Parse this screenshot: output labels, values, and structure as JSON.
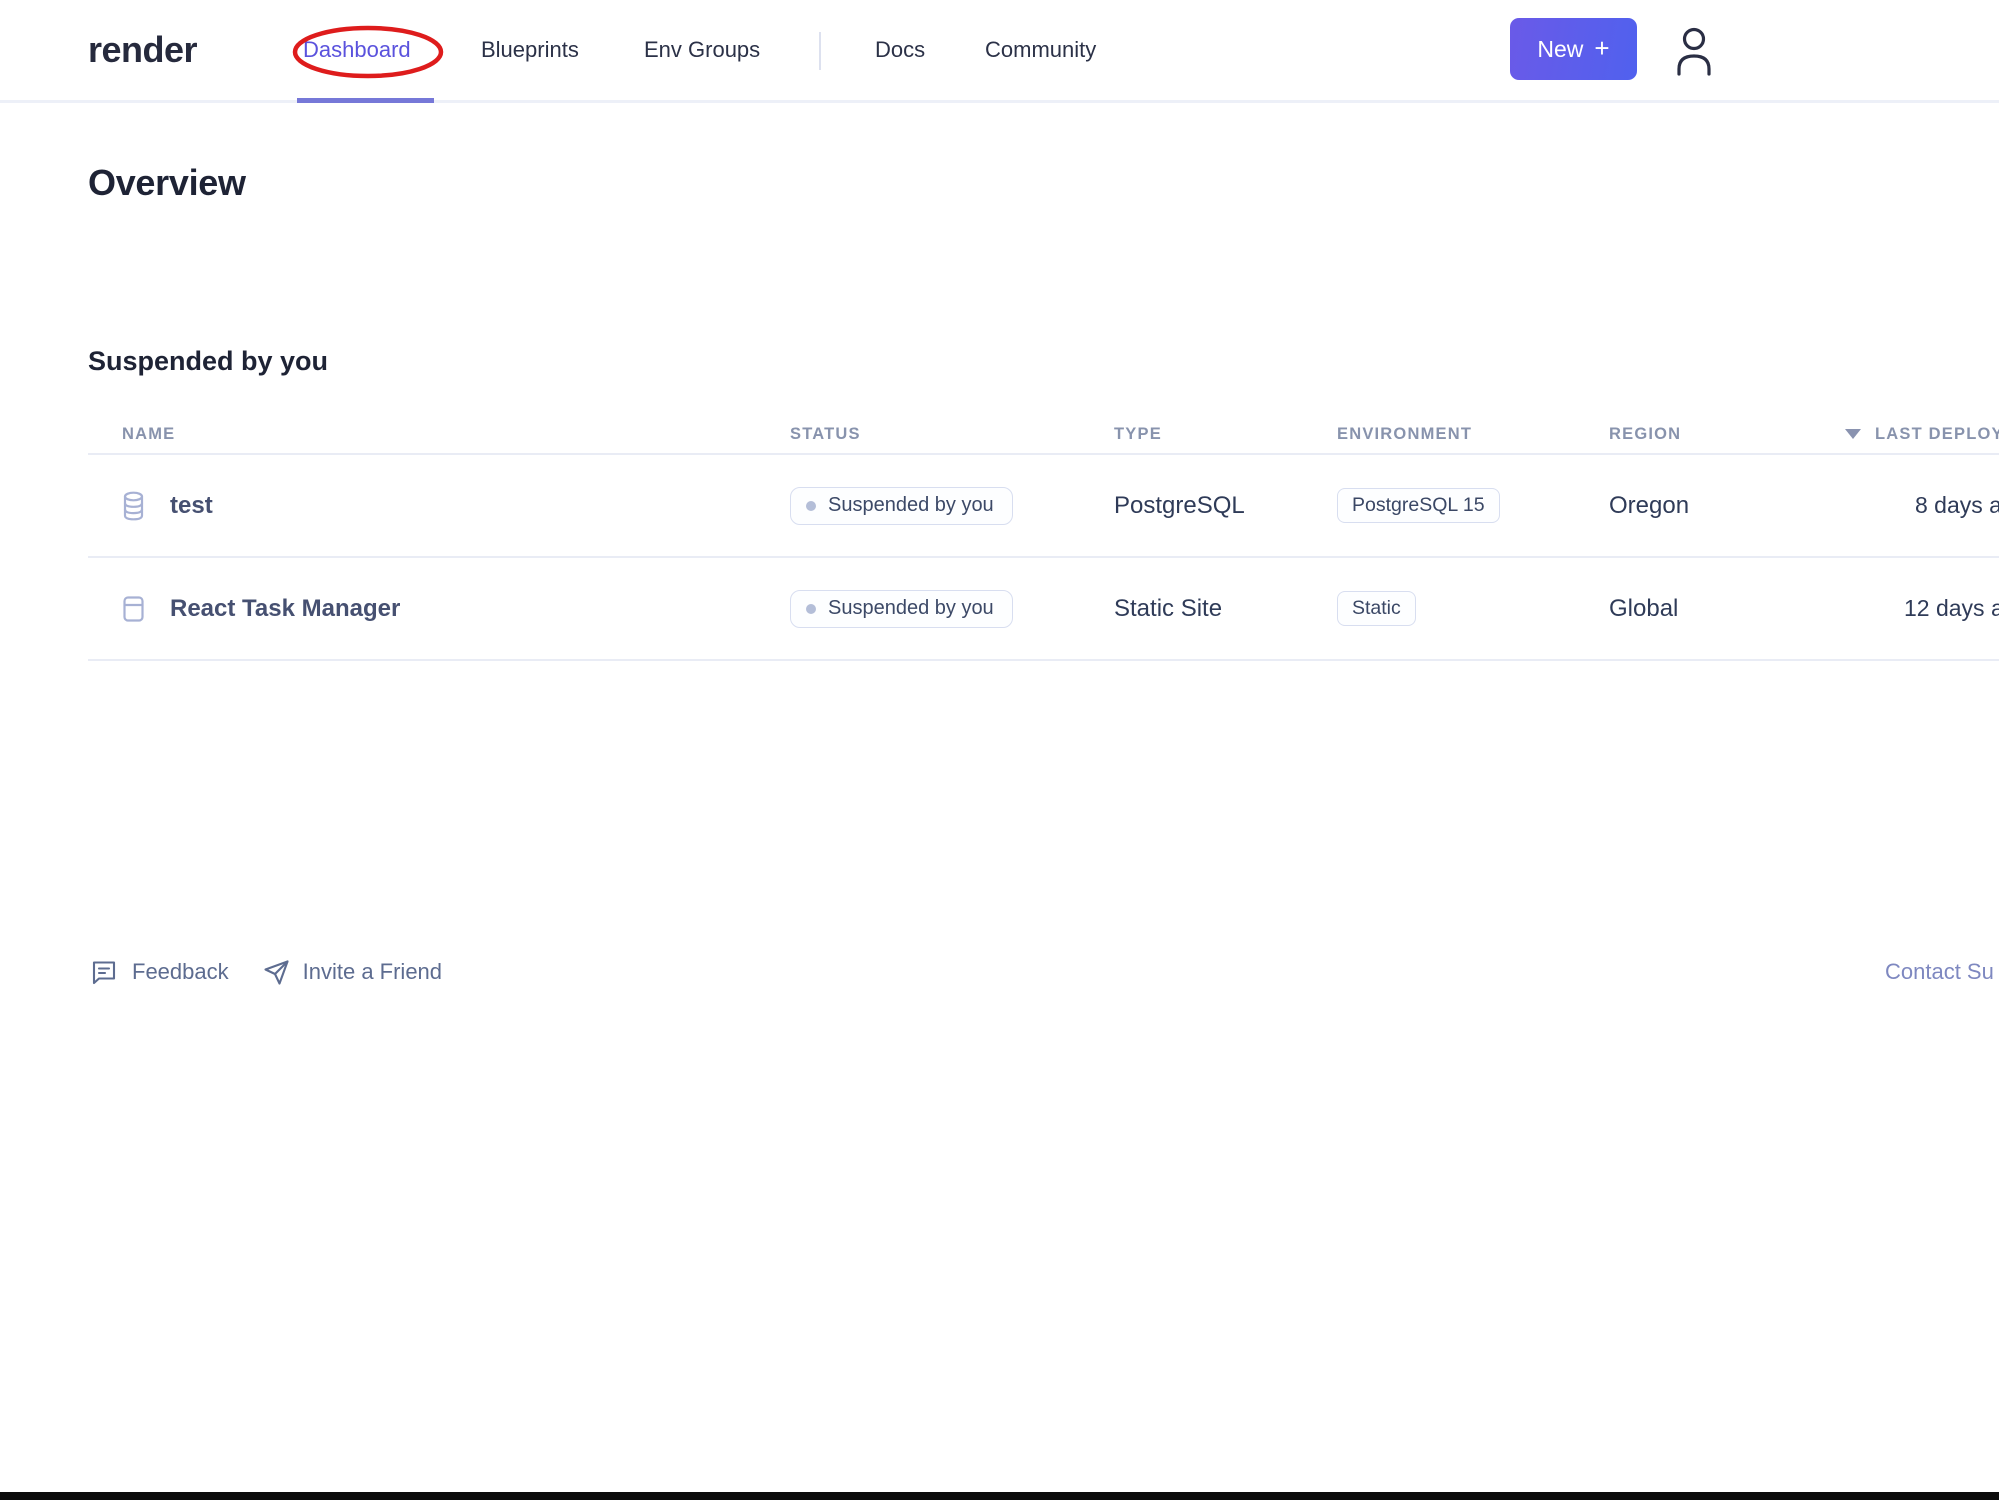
{
  "brand": {
    "logo": "render"
  },
  "nav": {
    "items": [
      {
        "label": "Dashboard",
        "active": true
      },
      {
        "label": "Blueprints",
        "active": false
      },
      {
        "label": "Env Groups",
        "active": false
      },
      {
        "label": "Docs",
        "active": false
      },
      {
        "label": "Community",
        "active": false
      }
    ],
    "new_button_label": "New",
    "new_button_plus": "+"
  },
  "annotation": {
    "shape": "red-ellipse",
    "target": "Dashboard",
    "color": "#de1c1c"
  },
  "page": {
    "title": "Overview",
    "section_title": "Suspended by you"
  },
  "table": {
    "columns": [
      "NAME",
      "STATUS",
      "TYPE",
      "ENVIRONMENT",
      "REGION",
      "LAST DEPLOY"
    ],
    "sorted_column": "LAST DEPLOY",
    "sort_direction": "descending",
    "rows": [
      {
        "icon": "database-icon",
        "name": "test",
        "status": "Suspended by you",
        "type": "PostgreSQL",
        "environment": "PostgreSQL 15",
        "region": "Oregon",
        "last_deploy": "8 days a"
      },
      {
        "icon": "static-site-icon",
        "name": "React Task Manager",
        "status": "Suspended by you",
        "type": "Static Site",
        "environment": "Static",
        "region": "Global",
        "last_deploy": "12 days a"
      }
    ]
  },
  "footer": {
    "feedback_label": "Feedback",
    "invite_label": "Invite a Friend",
    "contact_label": "Contact Su"
  },
  "colors": {
    "accent": "#5a52dd",
    "annotation_red": "#de1c1c",
    "button_gradient_start": "#6a5ae8",
    "button_gradient_end": "#5061ee",
    "table_header_gray": "#8893ad",
    "badge_border": "#d8def0"
  }
}
